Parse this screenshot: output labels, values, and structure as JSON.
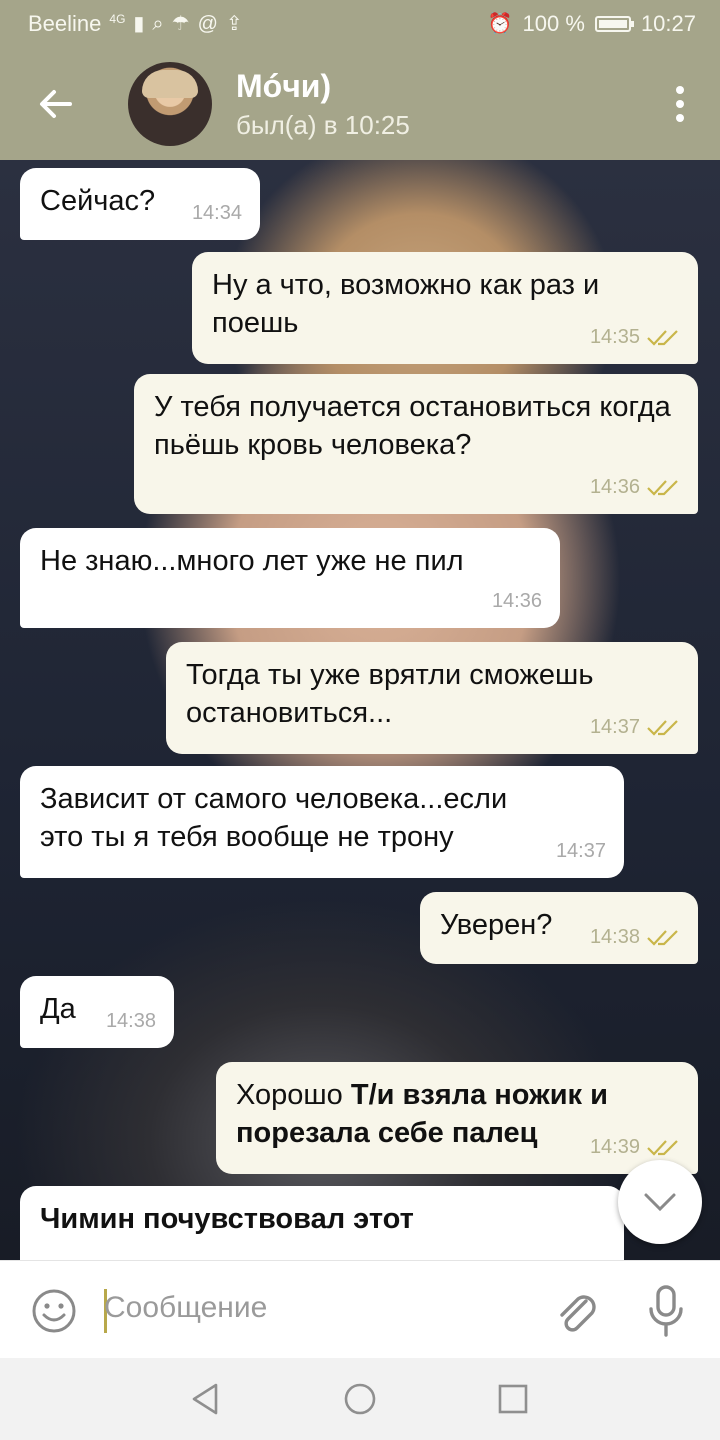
{
  "status_bar": {
    "carrier": "Beeline",
    "network": "4G",
    "battery": "100 %",
    "battery_level": 1.0,
    "time": "10:27"
  },
  "header": {
    "contact_name": "Мóчи)",
    "last_seen": "был(а) в 10:25"
  },
  "messages": [
    {
      "dir": "in",
      "text": "Сейчас?",
      "time": "14:34"
    },
    {
      "dir": "out",
      "text": "Ну а что, возможно как раз и поешь",
      "time": "14:35"
    },
    {
      "dir": "out",
      "text": "У тебя получается остановиться когда пьёшь кровь человека?",
      "time": "14:36"
    },
    {
      "dir": "in",
      "text": "Не знаю...много лет уже не пил",
      "time": "14:36"
    },
    {
      "dir": "out",
      "text": "Тогда ты уже врятли сможешь остановиться...",
      "time": "14:37"
    },
    {
      "dir": "in",
      "text": "Зависит от самого человека...если это ты я тебя вообще не трону",
      "time": "14:37"
    },
    {
      "dir": "out",
      "text": "Уверен?",
      "time": "14:38"
    },
    {
      "dir": "in",
      "text": "Да",
      "time": "14:38"
    },
    {
      "dir": "out",
      "text_plain": "Хорошо ",
      "text_bold": "Т/и взяла ножик и порезала себе палец",
      "time": "14:39"
    },
    {
      "dir": "in",
      "text": "Чимин почувствовал этот",
      "time": ""
    }
  ],
  "input": {
    "placeholder": "Сообщение"
  },
  "colors": {
    "header_bg": "#a5a58a",
    "incoming_bubble": "#ffffff",
    "outgoing_bubble": "#f8f6ea",
    "read_check": "#c9b64a"
  }
}
